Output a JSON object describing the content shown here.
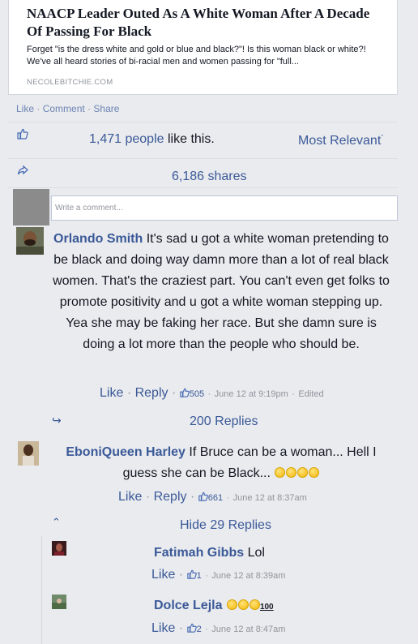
{
  "link_card": {
    "title": "NAACP Leader Outed As A White Woman After A Decade Of Passing For Black",
    "description": "Forget \"is the dress white and gold or blue and black?\"! Is this woman black or white?! We've all heard stories of bi-racial men and women passing for \"full...",
    "domain": "NECOLEBITCHIE.COM"
  },
  "post_actions": {
    "like": "Like",
    "comment": "Comment",
    "share": "Share",
    "separator": "·"
  },
  "likes_summary": {
    "count_text": "1,471 people",
    "suffix": "like this.",
    "sort_label": "Most Relevant",
    "sort_caret": "ˇ"
  },
  "shares_summary": {
    "text": "6,186 shares"
  },
  "comment_box": {
    "placeholder": "Write a comment..."
  },
  "comments": [
    {
      "author": "Orlando Smith",
      "text": "It's sad u got a white woman pretending to be black and doing way damn more than a lot of real black women. That's the craziest part. You can't even get folks to promote positivity and u got a white woman stepping up. Yea she may be faking her race. But she damn sure is doing a lot more than the people who should be.",
      "like_label": "Like",
      "reply_label": "Reply",
      "like_count": "505",
      "time": "June 12 at 9:19pm",
      "edited": "Edited",
      "replies_label": "200 Replies"
    },
    {
      "author": "EboniQueen Harley",
      "text": "If Bruce can be a woman... Hell I guess she can be Black...",
      "like_label": "Like",
      "reply_label": "Reply",
      "like_count": "661",
      "time": "June 12 at 8:37am",
      "hide_replies_label": "Hide 29 Replies"
    }
  ],
  "replies": [
    {
      "author": "Fatimah Gibbs",
      "text": "Lol",
      "like_label": "Like",
      "like_count": "1",
      "time": "June 12 at 8:39am"
    },
    {
      "author": "Dolce Lejla",
      "text_suffix": "100",
      "like_label": "Like",
      "like_count": "2",
      "time": "June 12 at 8:47am"
    }
  ],
  "icons": {
    "like_summary_icon": "thumbs-up-icon",
    "share_summary_icon": "share-arrow-icon",
    "reply_arrow_icon": "reply-arrow-icon",
    "hide_caret_icon": "chevron-up-icon",
    "emoji_icon": "grinning-face-icon"
  },
  "colors": {
    "link": "#3b5998",
    "background": "#e9ebee",
    "meta_gray": "#90949c"
  }
}
